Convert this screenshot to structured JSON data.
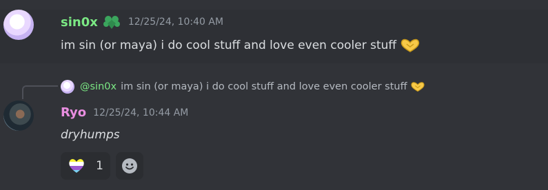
{
  "messages": [
    {
      "author": "sin0x",
      "timestamp": "12/25/24, 10:40 AM",
      "content": "im sin (or maya) i do cool stuff and love even cooler stuff",
      "badge_icon": "heart-flower-icon",
      "emoji_icon": "heart-hands-emoji"
    },
    {
      "reply_to": {
        "mention": "@sin0x",
        "content": "im sin (or maya) i do cool stuff and love even cooler stuff"
      },
      "author": "Ryo",
      "timestamp": "12/25/24, 10:44 AM",
      "content": "dryhumps",
      "reactions": [
        {
          "emoji": "pride-heart-emoji",
          "count": "1"
        },
        {
          "emoji": "add-reaction-icon"
        }
      ]
    }
  ],
  "colors": {
    "background": "#313338",
    "hover": "#2e3035",
    "name_green": "#7be884",
    "name_pink": "#e98ee0",
    "timestamp": "#949ba4"
  }
}
